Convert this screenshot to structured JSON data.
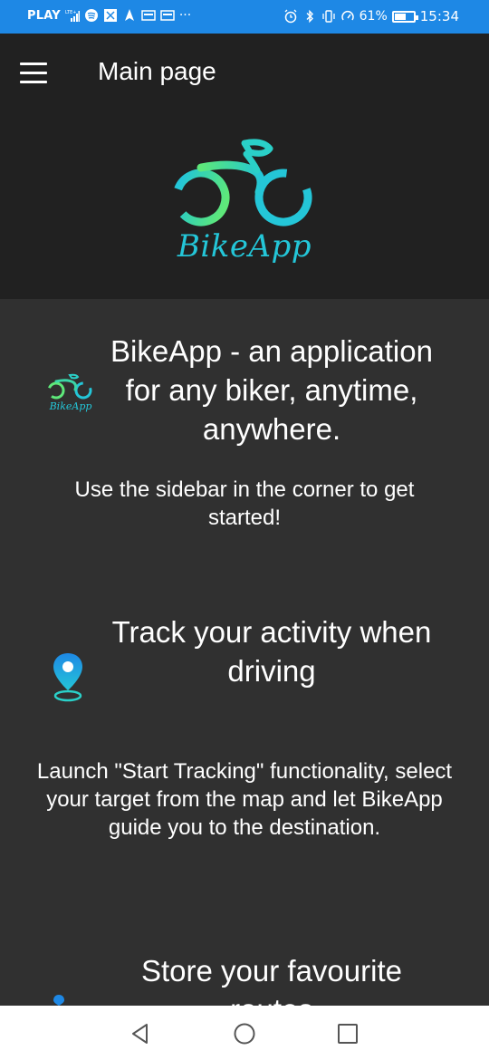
{
  "status_bar": {
    "carrier": "PLAY",
    "network": "LTE+",
    "battery_percent": "61%",
    "battery_level": 0.61,
    "time": "15:34",
    "more": "···"
  },
  "app_bar": {
    "title": "Main page"
  },
  "banner": {
    "brand": "BikeApp"
  },
  "sections": [
    {
      "title_lines": [
        "BikeApp - an application",
        "for any biker, anytime,",
        "anywhere."
      ],
      "text": "Use the sidebar in the corner to get started!",
      "icon_brand": "BikeApp"
    },
    {
      "title_lines": [
        "Track your activity when",
        "driving"
      ],
      "text": "Launch \"Start Tracking\" functionality, select your target from the map and let BikeApp guide you to the destination."
    },
    {
      "title_lines": [
        "Store your favourite",
        "routes"
      ]
    }
  ],
  "icons": {
    "menu": "hamburger-menu-icon",
    "logo": "bicycle-logo-icon",
    "location": "map-pin-icon",
    "back": "back-triangle-icon",
    "home": "home-circle-icon",
    "recents": "recents-square-icon"
  },
  "colors": {
    "status_bar": "#1e88e5",
    "app_bar": "#212121",
    "content_bg": "#303030",
    "brand_teal": "#24c6d8",
    "brand_green": "#5ee87a"
  }
}
